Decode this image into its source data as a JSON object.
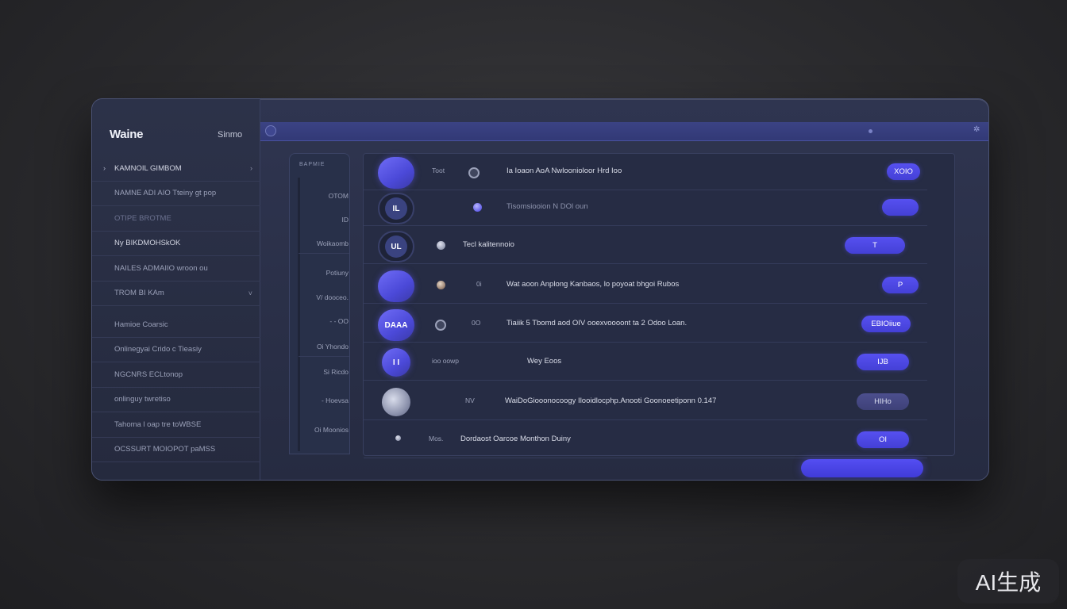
{
  "app": {
    "brand": "Waine",
    "brand_right": "Sinmo"
  },
  "sidebar": {
    "items": [
      {
        "lead": "›",
        "label": "KAMNOIL GIMBOM",
        "chev": "›",
        "tone": "bright"
      },
      {
        "label": "NAMNE ADI AIO Tteiny gt pop",
        "tone": "normal"
      },
      {
        "label": "OTIPE BROTME",
        "tone": "dim"
      },
      {
        "label": "Ny BIKDMOHSkOK",
        "tone": "bright"
      },
      {
        "label": "NAILES ADMAIIO wroon ou",
        "tone": "normal"
      },
      {
        "label": "TROM BI KAm",
        "chev": "˅",
        "tone": "normal"
      },
      {
        "label": "Hamioe Coarsic",
        "tone": "normal"
      },
      {
        "label": "Onlinegyai Crido c Tieasiy",
        "tone": "normal"
      },
      {
        "label": "NGCNRS ECLtonop",
        "tone": "normal"
      },
      {
        "label": "onlinguy twretiso",
        "tone": "normal"
      },
      {
        "label": "Tahoma l oap tre toWBSE",
        "tone": "normal"
      },
      {
        "label": "OCSSURT MOIOPOT paMSS",
        "tone": "normal"
      }
    ]
  },
  "panel": {
    "header": "BAPMIE",
    "items": [
      "OTOM",
      "ID",
      "Woikaomb",
      "Potiuny",
      "V/ dooceo.",
      "- - OO",
      "Oi Yhondo",
      "Si Ricdo",
      "- Hoevsa",
      "Oi Moonios"
    ]
  },
  "rows": [
    {
      "avatar": "",
      "avatar_style": "blue",
      "meta": "Toot",
      "badge": "ring",
      "text": "Ia Ioaon AoA Nwloonioloor Hrd Ioo",
      "pill": "XOIO",
      "pill_style": "blue"
    },
    {
      "avatar": "IL",
      "avatar_style": "dark",
      "meta": "",
      "badge": "blue",
      "text": "Tisomsiooion N DOl oun",
      "pill": "",
      "pill_style": "blue",
      "faded": true
    },
    {
      "avatar": "UL",
      "avatar_style": "dark",
      "meta": "",
      "badge": "grey",
      "text": "Tecl kalitennoio",
      "pill": "T",
      "pill_style": "blue"
    },
    {
      "avatar": "",
      "avatar_style": "blue",
      "meta": "0i",
      "badge": "brown",
      "text": "Wat aoon Anplong Kanbaos, lo poyoat bhgoi Rubos",
      "pill": "P",
      "pill_style": "blue"
    },
    {
      "avatar": "DAAA",
      "avatar_style": "blue",
      "meta": "0O",
      "badge": "ring",
      "text": "Tiaiik 5 Tbomd aod OIV ooexvoooont ta 2 Odoo Loan.",
      "pill": "EBIOiiue",
      "pill_style": "blue"
    },
    {
      "avatar": "I I",
      "avatar_style": "blue",
      "meta": "ioo oowp",
      "badge": "",
      "text": "Wey Eoos",
      "pill": "IJB",
      "pill_style": "blue"
    },
    {
      "avatar": "",
      "avatar_style": "grey",
      "meta": "NV",
      "badge": "",
      "text": "WaiDoGiooonocoogy Ilooidlocphp.Anooti Goonoeetiponn 0.147",
      "pill": "HIHo",
      "pill_style": "muted"
    },
    {
      "avatar": "",
      "avatar_style": "none",
      "meta": "Mos.",
      "badge": "",
      "text": "Dordaost Oarcoe Monthon Duiny",
      "pill": "OI",
      "pill_style": "blue"
    }
  ],
  "watermark": "AI生成"
}
